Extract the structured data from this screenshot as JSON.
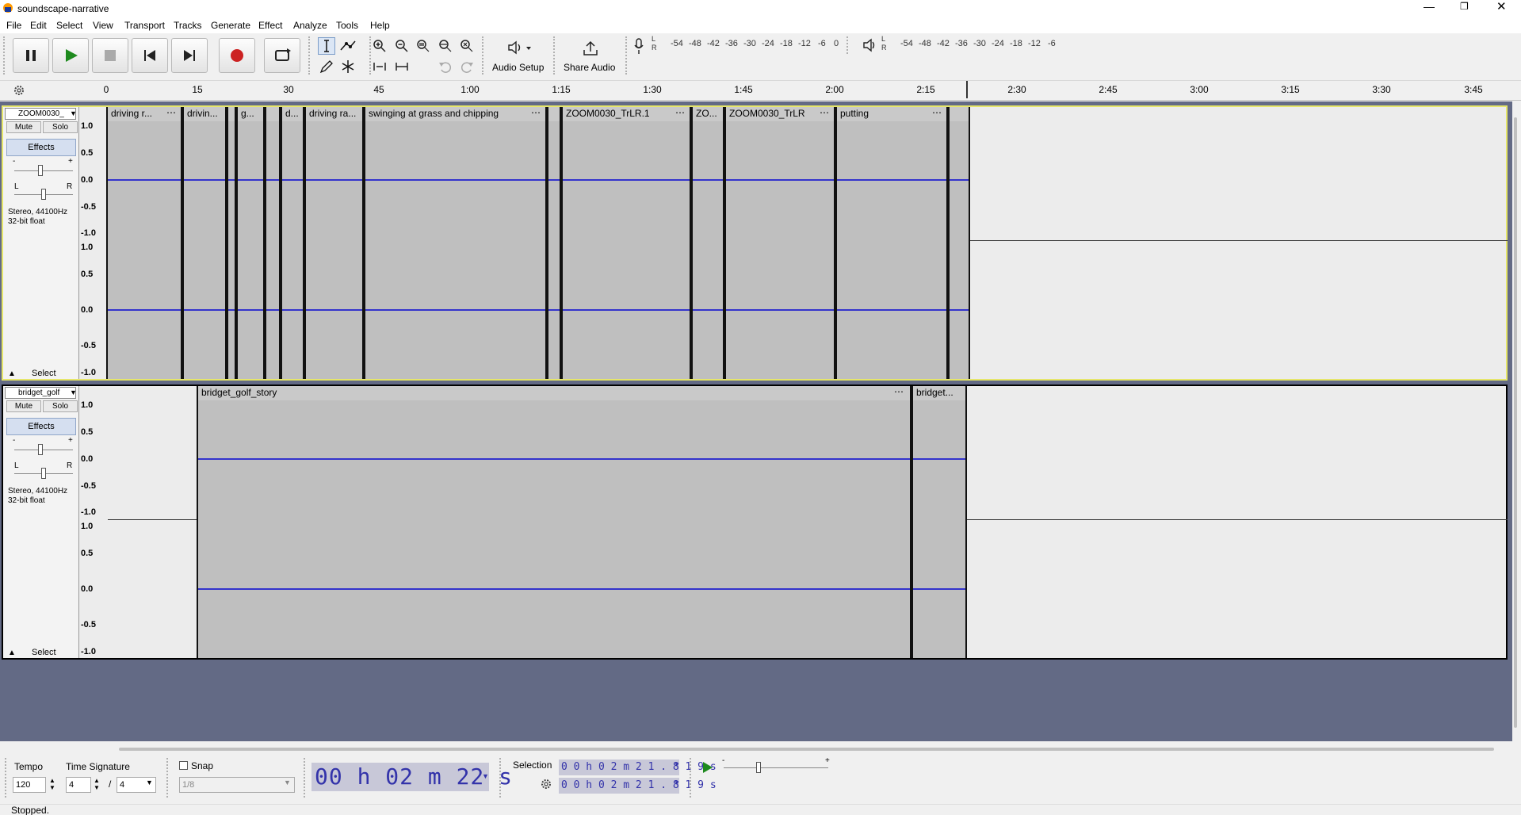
{
  "window": {
    "title": "soundscape-narrative"
  },
  "menu": [
    "File",
    "Edit",
    "Select",
    "View",
    "Transport",
    "Tracks",
    "Generate",
    "Effect",
    "Analyze",
    "Tools",
    "Help"
  ],
  "toolbar": {
    "audio_setup_label": "Audio Setup",
    "share_audio_label": "Share Audio",
    "record_meter_ticks": [
      "-54",
      "-48",
      "-42",
      "-36",
      "-30",
      "-24",
      "-18",
      "-12",
      "-6",
      "0"
    ],
    "play_meter_ticks": [
      "-54",
      "-48",
      "-42",
      "-36",
      "-30",
      "-24",
      "-18",
      "-12",
      "-6"
    ],
    "meter_channels": [
      "L",
      "R"
    ]
  },
  "ruler": {
    "ticks": [
      "0",
      "15",
      "30",
      "45",
      "1:00",
      "1:15",
      "1:30",
      "1:45",
      "2:00",
      "2:15",
      "2:30",
      "2:45",
      "3:00",
      "3:15",
      "3:30",
      "3:45"
    ]
  },
  "tracks": [
    {
      "name": "ZOOM0030_",
      "mute": "Mute",
      "solo": "Solo",
      "effects": "Effects",
      "gain_minus": "-",
      "gain_plus": "+",
      "pan_l": "L",
      "pan_r": "R",
      "info_line1": "Stereo, 44100Hz",
      "info_line2": "32-bit float",
      "select": "Select",
      "scale": [
        "1.0",
        "0.5",
        "0.0",
        "-0.5",
        "-1.0"
      ],
      "clips": [
        "driving r...",
        "drivin...",
        "",
        "g...",
        "",
        "d...",
        "driving ra...",
        "swinging at grass and chipping",
        "",
        "ZOOM0030_TrLR.1",
        "ZO...",
        "ZOOM0030_TrLR",
        "putting",
        ""
      ]
    },
    {
      "name": "bridget_golf",
      "mute": "Mute",
      "solo": "Solo",
      "effects": "Effects",
      "gain_minus": "-",
      "gain_plus": "+",
      "pan_l": "L",
      "pan_r": "R",
      "info_line1": "Stereo, 44100Hz",
      "info_line2": "32-bit float",
      "select": "Select",
      "scale": [
        "1.0",
        "0.5",
        "0.0",
        "-0.5",
        "-1.0"
      ],
      "clips": [
        "bridget_golf_story",
        "bridget..."
      ]
    }
  ],
  "bottom": {
    "tempo_label": "Tempo",
    "tempo_value": "120",
    "time_sig_label": "Time Signature",
    "time_sig_num": "4",
    "time_sig_sep": "/",
    "time_sig_den": "4",
    "snap_label": "Snap",
    "snap_value": "1/8",
    "timecode": "00 h 02 m 22 s",
    "selection_label": "Selection",
    "selection_start": "0 0 h 0 2 m 2 1 . 8 1 9 s",
    "selection_end": "0 0 h 0 2 m 2 1 . 8 1 9 s"
  },
  "status": "Stopped.",
  "colors": {
    "waveform": "#3333cc",
    "record": "#cc2222",
    "play": "#1e8a1e",
    "track_bg": "#636a85",
    "selected_track_border": "#e6e66a"
  }
}
